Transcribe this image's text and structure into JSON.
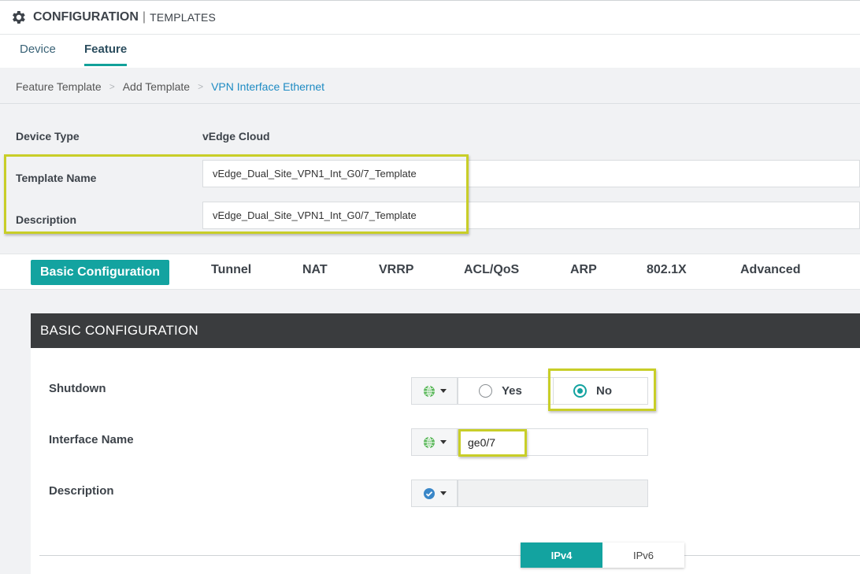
{
  "header": {
    "title": "CONFIGURATION",
    "separator": "|",
    "subtitle": "TEMPLATES",
    "icon": "gear-icon"
  },
  "tabs": [
    {
      "label": "Device",
      "active": false
    },
    {
      "label": "Feature",
      "active": true
    }
  ],
  "breadcrumb": {
    "items": [
      "Feature Template",
      "Add Template",
      "VPN Interface Ethernet"
    ],
    "separator": ">"
  },
  "template_info": {
    "device_type_label": "Device Type",
    "device_type_value": "vEdge Cloud",
    "template_name_label": "Template Name",
    "template_name_value": "vEdge_Dual_Site_VPN1_Int_G0/7_Template",
    "description_label": "Description",
    "description_value": "vEdge_Dual_Site_VPN1_Int_G0/7_Template"
  },
  "section_tabs": [
    {
      "label": "Basic Configuration",
      "active": true
    },
    {
      "label": "Tunnel"
    },
    {
      "label": "NAT"
    },
    {
      "label": "VRRP"
    },
    {
      "label": "ACL/QoS"
    },
    {
      "label": "ARP"
    },
    {
      "label": "802.1X"
    },
    {
      "label": "Advanced"
    }
  ],
  "basic_config": {
    "heading": "BASIC CONFIGURATION",
    "shutdown": {
      "label": "Shutdown",
      "scope_icon": "globe-icon",
      "options": [
        "Yes",
        "No"
      ],
      "selected": "No"
    },
    "interface_name": {
      "label": "Interface Name",
      "scope_icon": "globe-icon",
      "value": "ge0/7"
    },
    "description": {
      "label": "Description",
      "scope_icon": "check-circle-icon",
      "value": ""
    }
  },
  "ip_tabs": [
    {
      "label": "IPv4",
      "active": true
    },
    {
      "label": "IPv6",
      "active": false
    }
  ],
  "colors": {
    "accent": "#13a3a0",
    "highlight": "#c8ce28",
    "link": "#1e8bc3",
    "panel_header": "#3a3c3e"
  }
}
